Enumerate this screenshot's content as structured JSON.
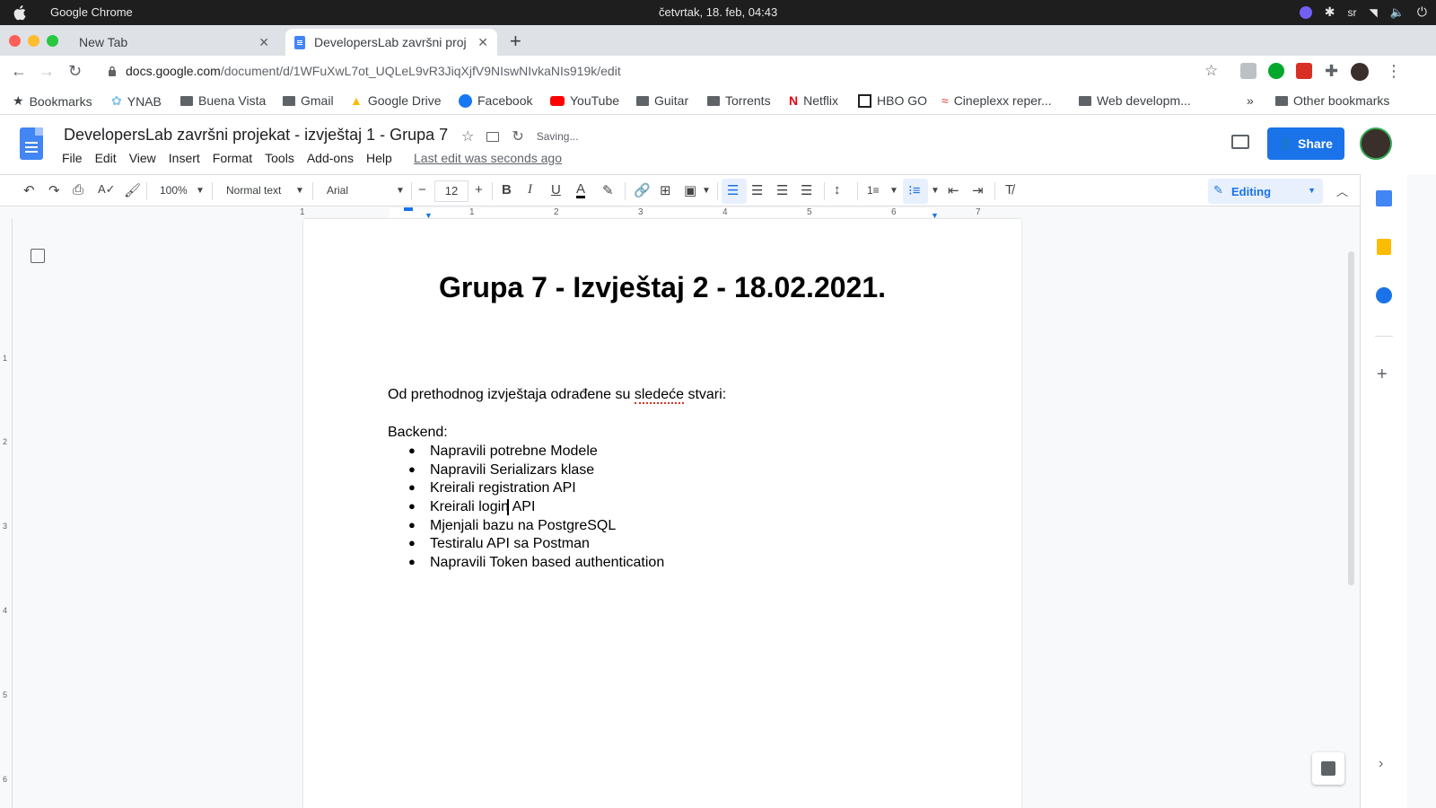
{
  "os": {
    "app_name": "Google Chrome",
    "clock": "četvrtak, 18. feb, 04:43",
    "lang": "sr"
  },
  "tabs": [
    {
      "label": "New Tab"
    },
    {
      "label": "DevelopersLab završni proj"
    }
  ],
  "omnibox": {
    "url_host": "docs.google.com",
    "url_path": "/document/d/1WFuXwL7ot_UQLeL9vR3JiqXjfV9NIswNIvkaNIs919k/edit"
  },
  "bookmarks": {
    "items": [
      "Bookmarks",
      "YNAB",
      "Buena Vista",
      "Gmail",
      "Google Drive",
      "Facebook",
      "YouTube",
      "Guitar",
      "Torrents",
      "Netflix",
      "HBO GO",
      "Cineplexx reper...",
      "Web developm..."
    ],
    "overflow": "»",
    "other": "Other bookmarks"
  },
  "doc": {
    "title": "DevelopersLab završni projekat - izvještaj 1 - Grupa 7",
    "saving": "Saving...",
    "menu": [
      "File",
      "Edit",
      "View",
      "Insert",
      "Format",
      "Tools",
      "Add-ons",
      "Help"
    ],
    "last_edit": "Last edit was seconds ago",
    "share_label": "Share"
  },
  "toolbar": {
    "zoom": "100%",
    "style": "Normal text",
    "font": "Arial",
    "font_size": "12",
    "mode": "Editing"
  },
  "ruler": {
    "marks": [
      "1",
      "1",
      "2",
      "3",
      "4",
      "5",
      "6",
      "7"
    ],
    "vmarks": [
      "1",
      "2",
      "3",
      "4",
      "5",
      "6"
    ]
  },
  "content": {
    "heading": "Grupa 7 - Izvještaj 2 - 18.02.2021.",
    "intro_a": "Od prethodnog izvještaja odrađene su ",
    "intro_b": "sledeće",
    "intro_c": " stvari:",
    "section": "Backend:",
    "bullets": [
      "Napravili potrebne Modele",
      "Napravili Serializars klase",
      "Kreirali registration API",
      "Kreirali login API",
      "Mjenjali bazu na PostgreSQL",
      "Testiralu API sa Postman",
      "Napravili Token based authentication"
    ]
  },
  "colors": {
    "accent": "#1a73e8",
    "docs_blue": "#4285f4"
  }
}
